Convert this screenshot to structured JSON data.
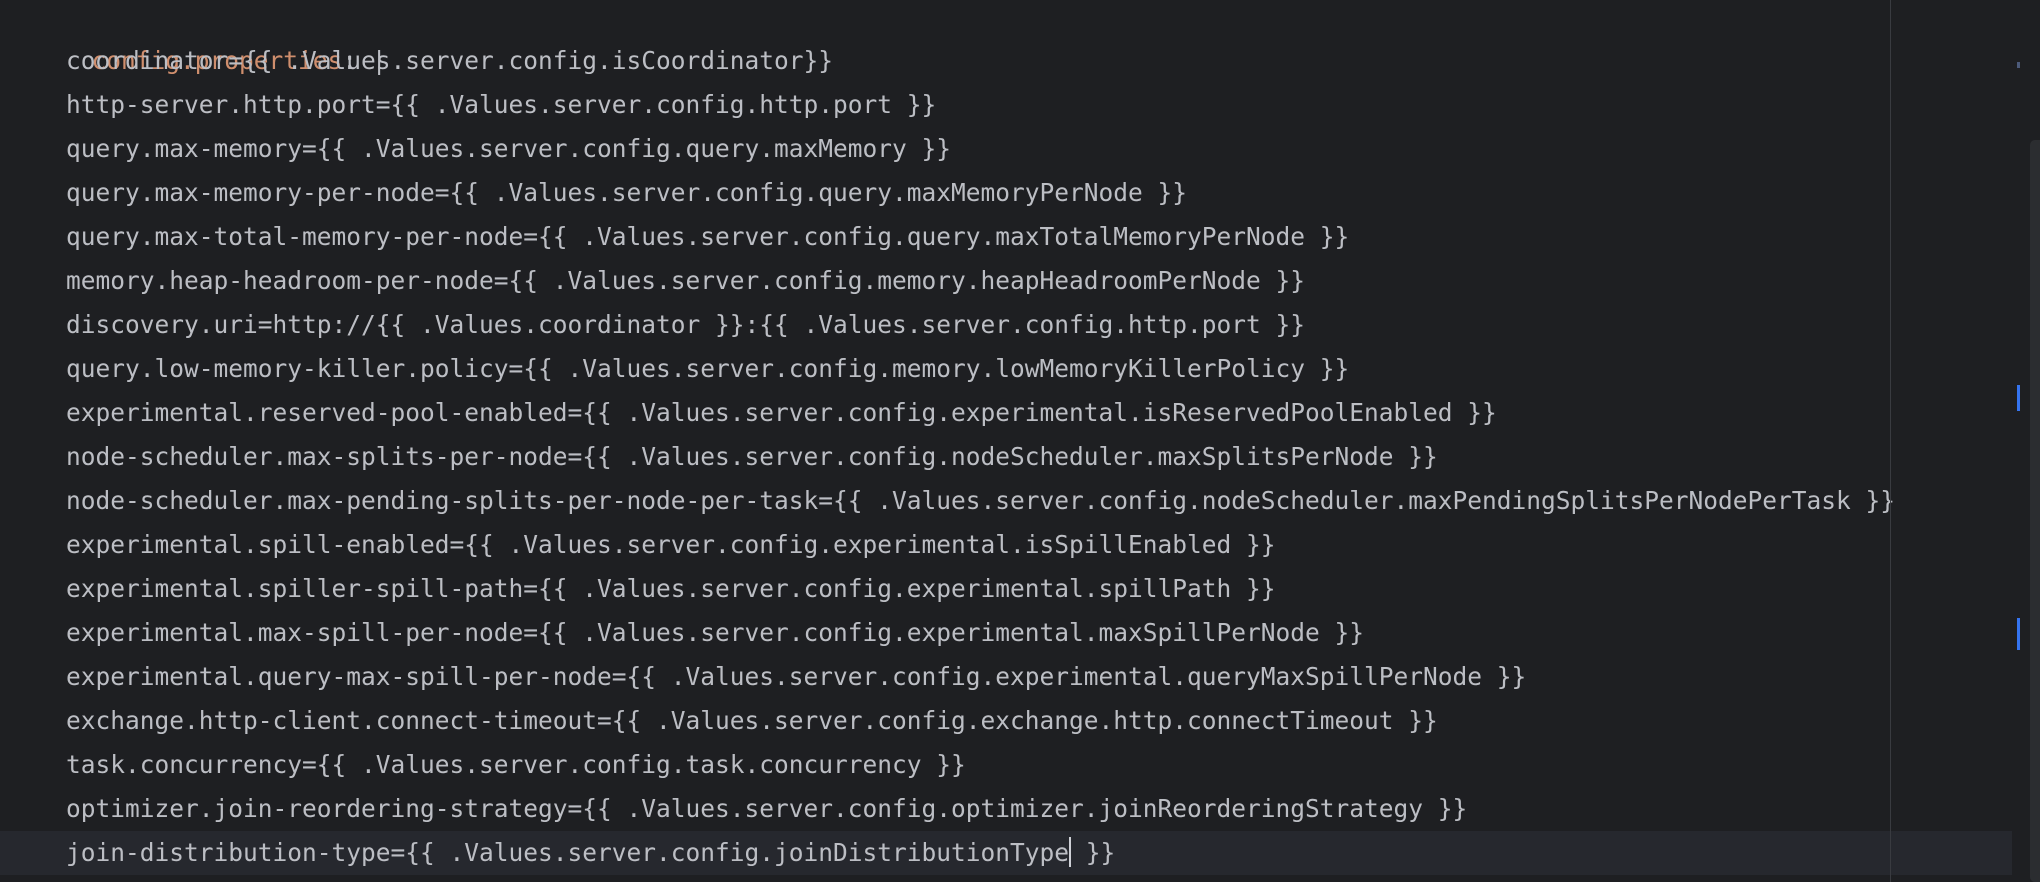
{
  "editor": {
    "root_key": "config.properties",
    "root_colon": ":",
    "root_pipe": " |",
    "lines": [
      "coordinator={{ .Values.server.config.isCoordinator}}",
      "http-server.http.port={{ .Values.server.config.http.port }}",
      "query.max-memory={{ .Values.server.config.query.maxMemory }}",
      "query.max-memory-per-node={{ .Values.server.config.query.maxMemoryPerNode }}",
      "query.max-total-memory-per-node={{ .Values.server.config.query.maxTotalMemoryPerNode }}",
      "memory.heap-headroom-per-node={{ .Values.server.config.memory.heapHeadroomPerNode }}",
      "discovery.uri=http://{{ .Values.coordinator }}:{{ .Values.server.config.http.port }}",
      "query.low-memory-killer.policy={{ .Values.server.config.memory.lowMemoryKillerPolicy }}",
      "experimental.reserved-pool-enabled={{ .Values.server.config.experimental.isReservedPoolEnabled }}",
      "node-scheduler.max-splits-per-node={{ .Values.server.config.nodeScheduler.maxSplitsPerNode }}",
      "node-scheduler.max-pending-splits-per-node-per-task={{ .Values.server.config.nodeScheduler.maxPendingSplitsPerNodePerTask }}",
      "experimental.spill-enabled={{ .Values.server.config.experimental.isSpillEnabled }}",
      "experimental.spiller-spill-path={{ .Values.server.config.experimental.spillPath }}",
      "experimental.max-spill-per-node={{ .Values.server.config.experimental.maxSpillPerNode }}",
      "experimental.query-max-spill-per-node={{ .Values.server.config.experimental.queryMaxSpillPerNode }}",
      "exchange.http-client.connect-timeout={{ .Values.server.config.exchange.http.connectTimeout }}",
      "task.concurrency={{ .Values.server.config.task.concurrency }}",
      "optimizer.join-reordering-strategy={{ .Values.server.config.optimizer.joinReorderingStrategy }}"
    ],
    "last_line_before_caret": "join-distribution-type={{ .Values.server.config.joinDistributionType",
    "last_line_after_caret": " }}"
  },
  "colors": {
    "background": "#1e1f22",
    "current_line": "#26282e",
    "text": "#bcbec4",
    "key": "#cf8e6d",
    "marker": "#3574f0"
  }
}
